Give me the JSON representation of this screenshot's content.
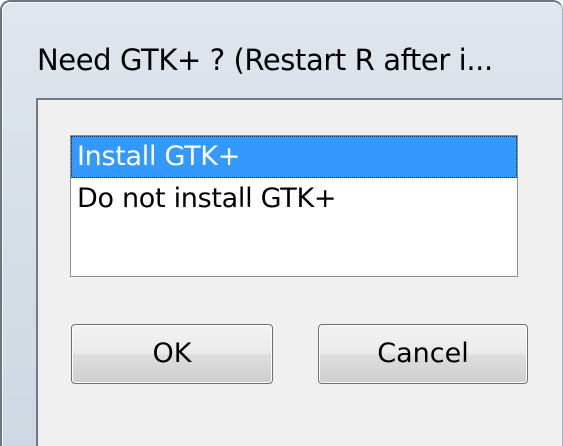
{
  "window": {
    "title": "Need GTK+ ? (Restart R after i..."
  },
  "list": {
    "items": [
      {
        "label": "Install GTK+",
        "selected": true
      },
      {
        "label": "Do not install GTK+",
        "selected": false
      }
    ]
  },
  "buttons": {
    "ok_label": "OK",
    "cancel_label": "Cancel"
  },
  "colors": {
    "selection": "#3399ff",
    "frame": "#d6dee7",
    "client": "#f0f0f0"
  }
}
